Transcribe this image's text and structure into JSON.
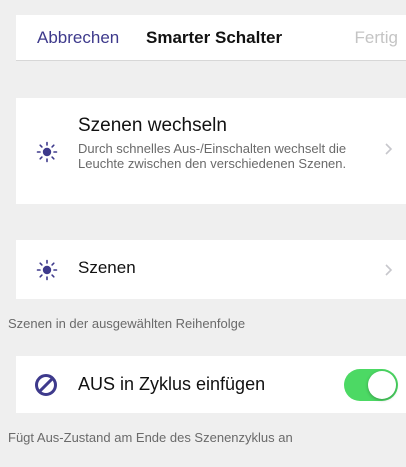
{
  "nav": {
    "cancel_label": "Abbrechen",
    "title": "Smarter Schalter",
    "done_label": "Fertig"
  },
  "rows": {
    "scene_switch": {
      "title": "Szenen wechseln",
      "description": "Durch schnelles Aus-/Einschalten wechselt die Leuchte zwischen den verschiedenen Szenen.",
      "icon": "sun-icon"
    },
    "scenes": {
      "title": "Szenen",
      "icon": "sun-icon",
      "caption": "Szenen in der ausgewählten Reihenfolge"
    },
    "off_in_cycle": {
      "title": "AUS in Zyklus einfügen",
      "icon": "ban-icon",
      "toggle_on": true,
      "caption": "Fügt Aus-Zustand am Ende des Szenenzyklus an"
    }
  },
  "colors": {
    "accent": "#3e3a8c",
    "toggle_on": "#4cd964",
    "disabled_text": "#c4c4c4",
    "background": "#efefef"
  }
}
